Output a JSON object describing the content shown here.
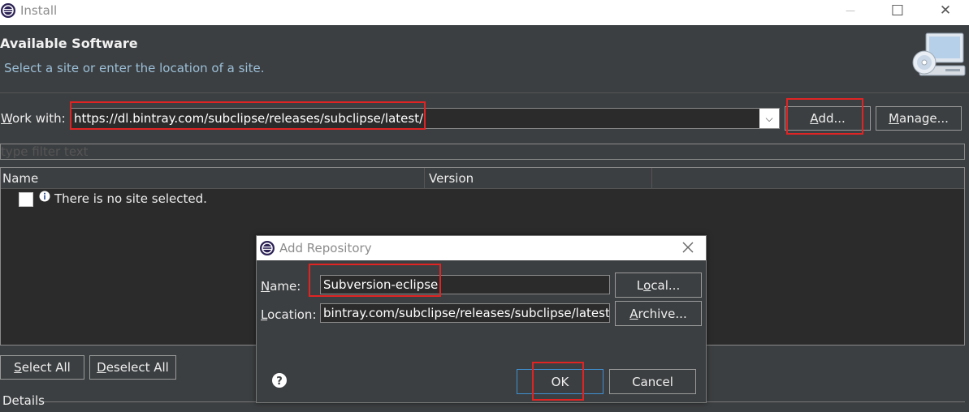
{
  "window": {
    "title": "Install",
    "minimize_glyph": "—",
    "maximize_glyph": "☐",
    "close_glyph": "✕"
  },
  "header": {
    "title": "Available Software",
    "subtitle": "Select a site or enter the location of a site."
  },
  "work_with": {
    "label_first": "W",
    "label_rest": "ork with:",
    "value": "https://dl.bintray.com/subclipse/releases/subclipse/latest/",
    "dropdown_glyph": "⌵"
  },
  "buttons": {
    "add_u": "A",
    "add_rest": "dd...",
    "manage_u": "M",
    "manage_rest": "anage...",
    "select_all_u": "S",
    "select_all_rest": "elect All",
    "deselect_all_u": "D",
    "deselect_all_rest": "eselect All"
  },
  "filter": {
    "placeholder": "type filter text"
  },
  "table": {
    "columns": [
      "Name",
      "Version"
    ],
    "rows": [
      {
        "text": "There is no site selected.",
        "checked": false
      }
    ]
  },
  "details": {
    "label": "Details"
  },
  "dialog": {
    "title": "Add Repository",
    "name_label_u": "N",
    "name_label_rest": "ame:",
    "name_value": "Subversion-eclipse",
    "location_label_u": "L",
    "location_label_rest": "ocation:",
    "location_value": "bintray.com/subclipse/releases/subclipse/latest/",
    "local_pre": "L",
    "local_u": "o",
    "local_rest": "cal...",
    "archive_u": "A",
    "archive_rest": "rchive...",
    "ok_label": "OK",
    "cancel_label": "Cancel"
  },
  "colors": {
    "background": "#3c3f41",
    "input_background": "#2b2b2b",
    "highlight_box": "#e02424",
    "subtitle": "#9bbfd8",
    "ok_border": "#3f8fd0"
  }
}
